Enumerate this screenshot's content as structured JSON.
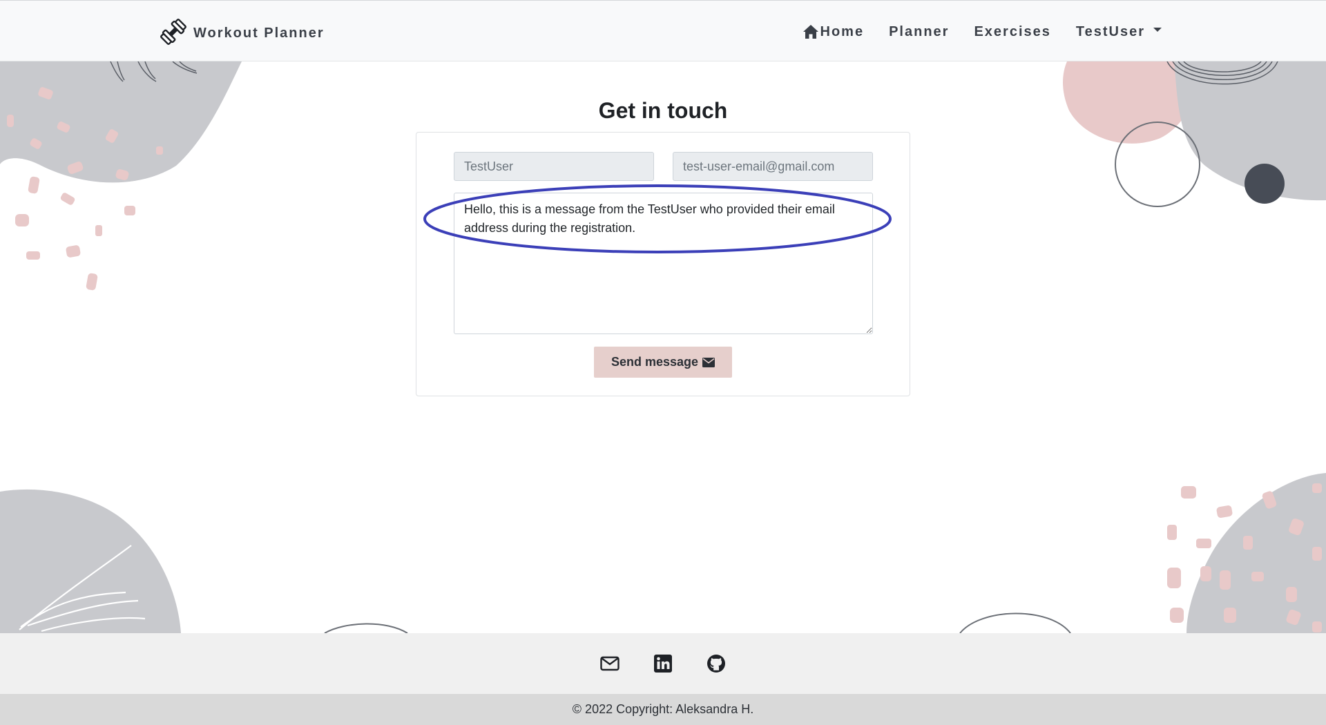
{
  "navbar": {
    "brand_label": "Workout Planner",
    "brand_icon": "dumbbell-icon",
    "links": [
      {
        "label": "Home",
        "icon": "home-icon"
      },
      {
        "label": "Planner"
      },
      {
        "label": "Exercises"
      },
      {
        "label": "TestUser",
        "icon": "caret-down-icon"
      }
    ]
  },
  "contact": {
    "title": "Get in touch",
    "name_placeholder": "TestUser",
    "email_placeholder": "test-user-email@gmail.com",
    "message_value": "Hello, this is a message from the TestUser who provided their email address during the registration.",
    "send_label": "Send message",
    "send_icon": "envelope-icon"
  },
  "footer": {
    "icons": [
      "envelope-icon",
      "linkedin-icon",
      "github-icon"
    ],
    "copyright": "© 2022 Copyright: Aleksandra H."
  },
  "colors": {
    "navbar_bg": "#f8f9fa",
    "button_bg": "#e6cfcc",
    "annotation": "#3b3fb8",
    "blob_gray": "#c8c9cd",
    "blob_pink": "#e8c9c9",
    "footer_bg": "#f0f0f0",
    "copyright_bg": "#d9d9d9"
  }
}
